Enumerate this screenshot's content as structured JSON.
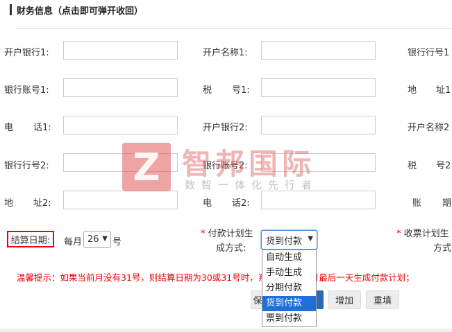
{
  "section": {
    "title": "财务信息（点击即可弹开收回）"
  },
  "fields": {
    "row1": {
      "l1": "开户银行1:",
      "l2": "开户名称1:",
      "l3": "银行行号1"
    },
    "row2": {
      "l1": "银行账号1:",
      "l2_a": "税",
      "l2_b": "号1:",
      "l3_a": "地",
      "l3_b": "址1"
    },
    "row3": {
      "l1_a": "电",
      "l1_b": "话1:",
      "l2": "开户银行2:",
      "l3": "开户名称2"
    },
    "row4": {
      "l1": "银行行号2:",
      "l2": "银行账号2:",
      "l3_a": "税",
      "l3_b": "号2"
    },
    "row5": {
      "l1_a": "地",
      "l1_b": "址2:",
      "l2_a": "电",
      "l2_b": "话2:",
      "l3_a": "账",
      "l3_b": "期"
    }
  },
  "settlement": {
    "label": "结算日期:",
    "prefix": "每月",
    "day": "26",
    "suffix": "号"
  },
  "payment_plan": {
    "required_mark": "*",
    "label_line1": "付款计划生",
    "label_line2": "成方式:",
    "selected": "货到付款",
    "options": [
      "自动生成",
      "手动生成",
      "分期付款",
      "货到付款",
      "票到付款"
    ]
  },
  "receipt_plan": {
    "required_mark": "*",
    "label_line1": "收票计划生",
    "label_line2": "方式"
  },
  "hint": "温馨提示：如果当前月没有31号，则结算日期为30或31号时，系统将在当前月最后一天生成付款计划；",
  "buttons": {
    "save": "保",
    "add": "增加",
    "reset": "重填"
  },
  "watermark": {
    "logo_letter": "Z",
    "name": "智邦国际",
    "slogan": "数智一体化先行者"
  },
  "colors": {
    "accent_red": "#e00000",
    "select_blue": "#1e6fd9"
  }
}
